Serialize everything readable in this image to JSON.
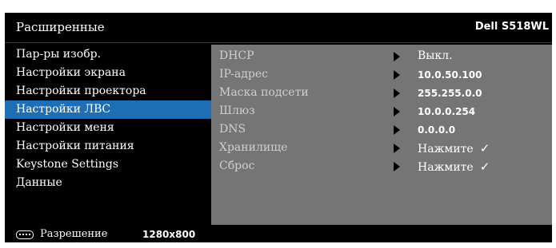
{
  "header": {
    "title": "Расширенные",
    "model": "Dell S518WL"
  },
  "menu": [
    {
      "label": "Пар-ры изобр."
    },
    {
      "label": "Настройки экрана"
    },
    {
      "label": "Настройки проектора"
    },
    {
      "label": "Настройки ЛВС",
      "selected": true
    },
    {
      "label": "Настройки меня"
    },
    {
      "label": "Настройки питания"
    },
    {
      "label": "Keystone Settings"
    },
    {
      "label": "Данные"
    }
  ],
  "settings": [
    {
      "label": "DHCP",
      "value": "Выкл."
    },
    {
      "label": "IP-адрес",
      "value": "10.0.50.100"
    },
    {
      "label": "Маска подсети",
      "value": "255.255.0.0"
    },
    {
      "label": "Шлюз",
      "value": "10.0.0.254"
    },
    {
      "label": "DNS",
      "value": "0.0.0.0"
    },
    {
      "label": "Хранилище",
      "value": "Нажмите",
      "check": "✓"
    },
    {
      "label": "Сброс",
      "value": "Нажмите",
      "check": "✓"
    }
  ],
  "footer": {
    "label": "Разрешение",
    "value": "1280x800"
  },
  "colors": {
    "background": "#000000",
    "selected": "#1e6eb6",
    "panel": "#757575"
  },
  "icons": {
    "arrow": "triangle-right-icon",
    "check": "check-icon",
    "keyboard": "keyboard-icon"
  }
}
